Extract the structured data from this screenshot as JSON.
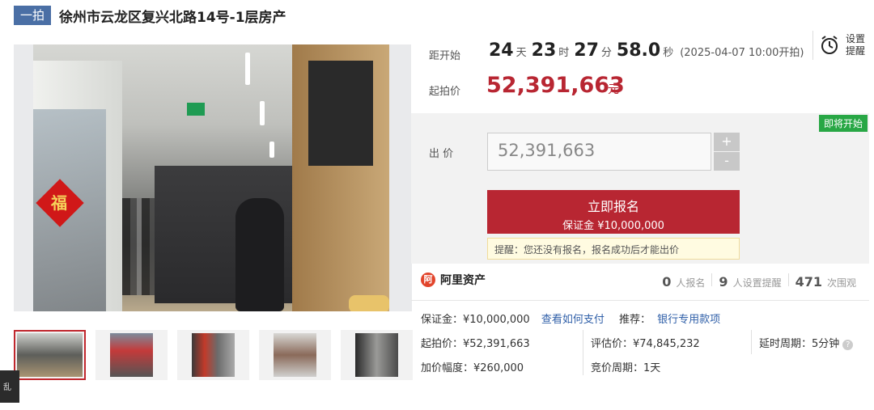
{
  "header": {
    "tag": "一拍",
    "title": "徐州市云龙区复兴北路14号-1层房产"
  },
  "countdown": {
    "label": "距开始",
    "days": "24",
    "days_unit": "天",
    "hours": "23",
    "hours_unit": "时",
    "minutes": "27",
    "minutes_unit": "分",
    "seconds": "58.0",
    "seconds_unit": "秒",
    "start_note": "(2025-04-07 10:00开拍)"
  },
  "reminder": {
    "label": "设置提醒"
  },
  "start_price": {
    "label": "起拍价",
    "value": "52,391,663",
    "unit": "元"
  },
  "bid": {
    "status_tag": "即将开始",
    "label": "出 价",
    "value": "52,391,663",
    "plus": "+",
    "minus": "-",
    "signup_label": "立即报名",
    "deposit_label": "保证金 ¥10,000,000",
    "tip": "提醒：您还没有报名，报名成功后才能出价"
  },
  "platform": {
    "logo_char": "阿",
    "name": "阿里资产"
  },
  "stats": {
    "signups": "0",
    "signups_label": "人报名",
    "reminders": "9",
    "reminders_label": "人设置提醒",
    "views": "471",
    "views_label": "次围观"
  },
  "details": {
    "deposit": "保证金：¥10,000,000",
    "how_to_pay": "查看如何支付",
    "recommend_label": "推荐：",
    "recommend_link": "银行专用款项",
    "start_price": "起拍价：¥52,391,663",
    "appraisal": "评估价：¥74,845,232",
    "delay": "延时周期：5分钟",
    "increment": "加价幅度：¥260,000",
    "cycle": "竞价周期：1天"
  },
  "side_tab": "乱",
  "colors": {
    "accent_red": "#b82632",
    "tag_blue": "#4a6fa5",
    "status_green": "#28a745",
    "link_blue": "#2f5fa8"
  }
}
